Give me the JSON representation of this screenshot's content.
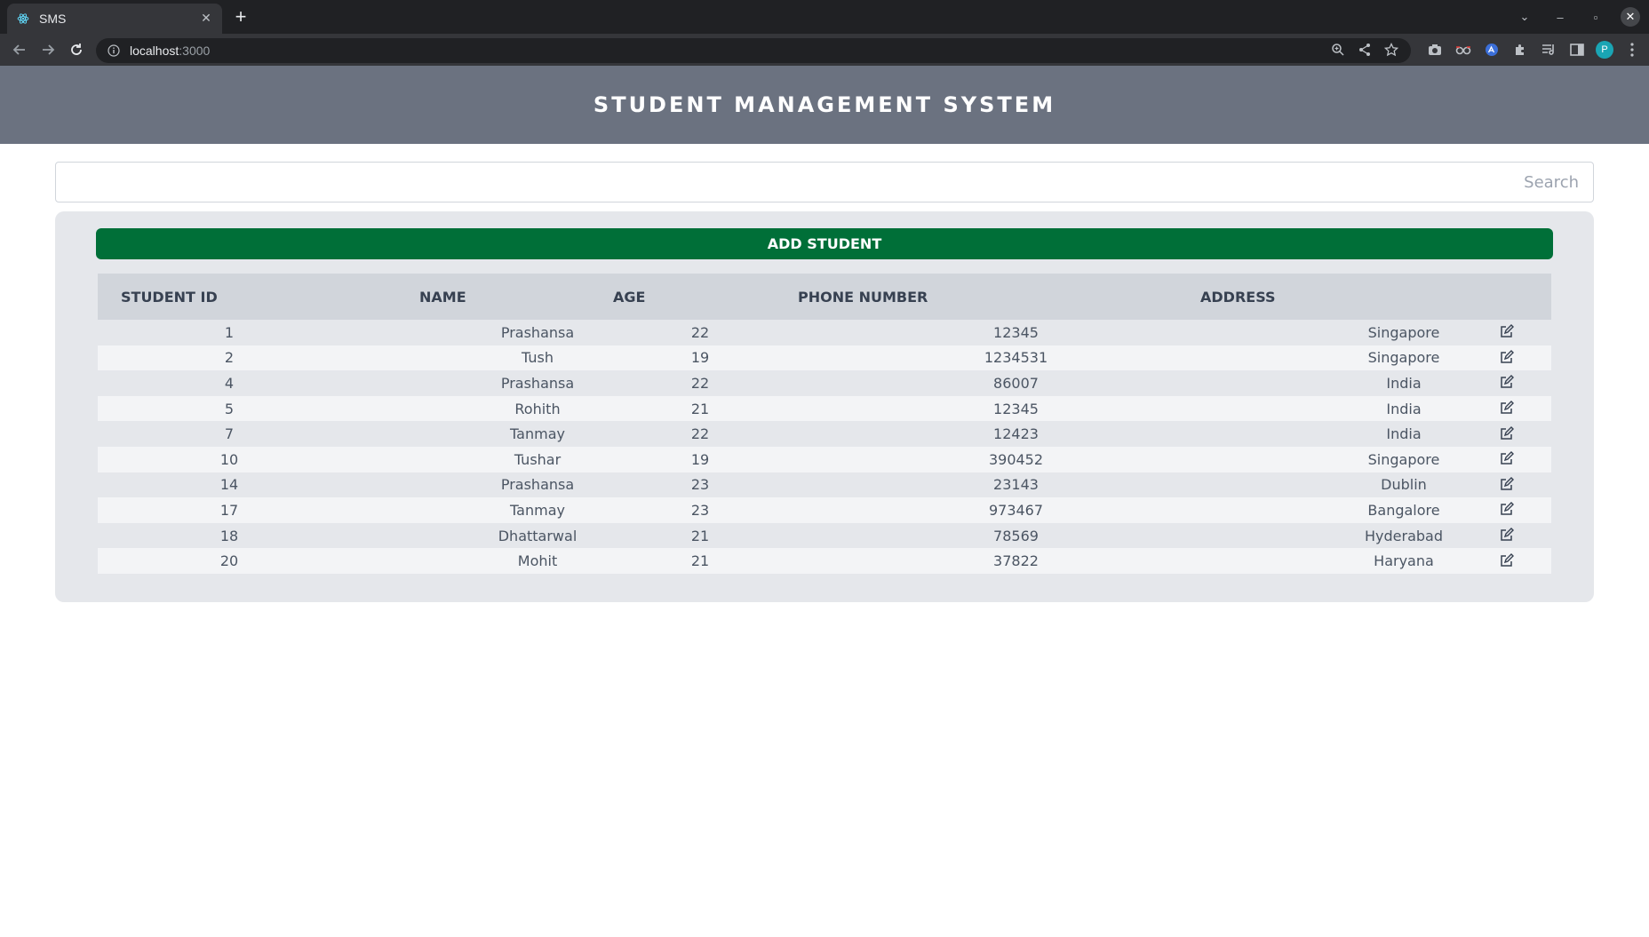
{
  "browser": {
    "tab_title": "SMS",
    "url_host": "localhost",
    "url_port": ":3000",
    "avatar_initial": "P"
  },
  "app": {
    "title": "STUDENT MANAGEMENT SYSTEM",
    "search_placeholder": "Search",
    "search_value": "",
    "add_button_label": "ADD STUDENT",
    "accent_color": "#006f38",
    "header_color": "#6b7280"
  },
  "table": {
    "columns": [
      "STUDENT ID",
      "NAME",
      "AGE",
      "PHONE NUMBER",
      "ADDRESS",
      ""
    ],
    "rows": [
      {
        "id": "1",
        "name": "Prashansa",
        "age": "22",
        "phone": "12345",
        "address": "Singapore"
      },
      {
        "id": "2",
        "name": "Tush",
        "age": "19",
        "phone": "1234531",
        "address": "Singapore"
      },
      {
        "id": "4",
        "name": "Prashansa",
        "age": "22",
        "phone": "86007",
        "address": "India"
      },
      {
        "id": "5",
        "name": "Rohith",
        "age": "21",
        "phone": "12345",
        "address": "India"
      },
      {
        "id": "7",
        "name": "Tanmay",
        "age": "22",
        "phone": "12423",
        "address": "India"
      },
      {
        "id": "10",
        "name": "Tushar",
        "age": "19",
        "phone": "390452",
        "address": "Singapore"
      },
      {
        "id": "14",
        "name": "Prashansa",
        "age": "23",
        "phone": "23143",
        "address": "Dublin"
      },
      {
        "id": "17",
        "name": "Tanmay",
        "age": "23",
        "phone": "973467",
        "address": "Bangalore"
      },
      {
        "id": "18",
        "name": "Dhattarwal",
        "age": "21",
        "phone": "78569",
        "address": "Hyderabad"
      },
      {
        "id": "20",
        "name": "Mohit",
        "age": "21",
        "phone": "37822",
        "address": "Haryana"
      }
    ],
    "row_action_icon": "edit-icon"
  }
}
